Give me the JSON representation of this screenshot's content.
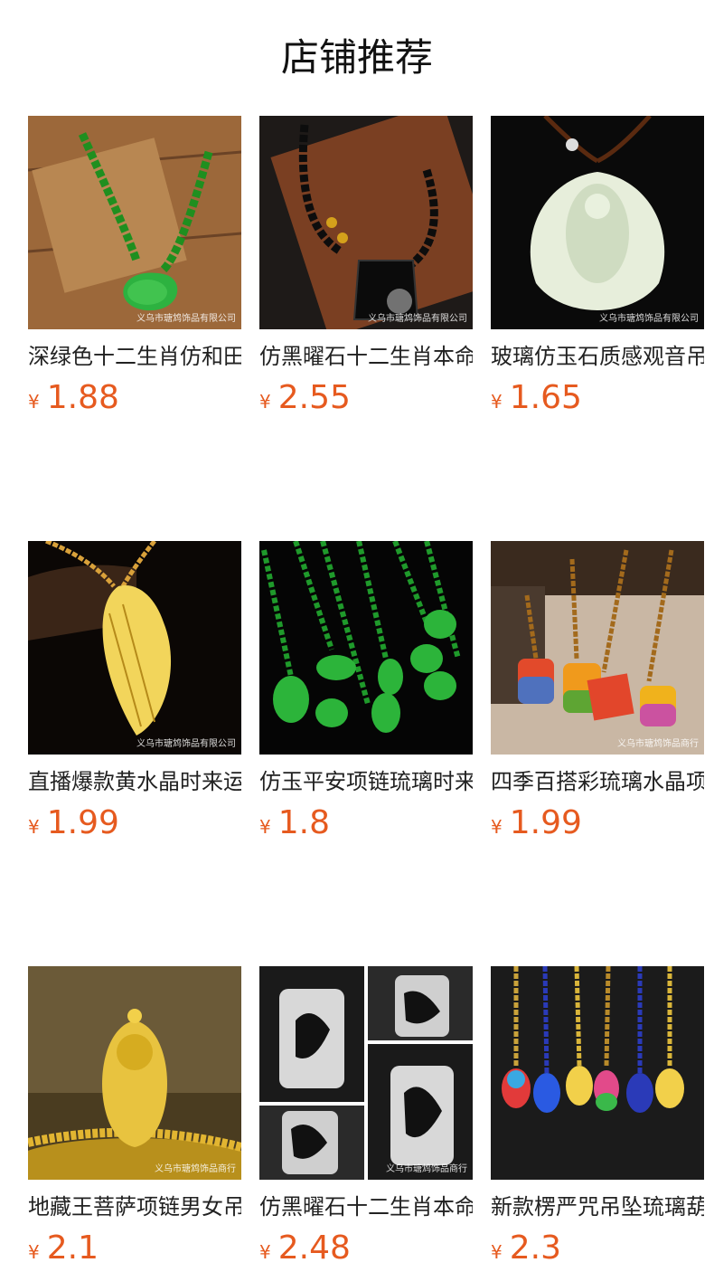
{
  "header": {
    "title": "店铺推荐"
  },
  "products": [
    {
      "name": "深绿色十二生肖仿和田玉",
      "currency": "¥",
      "price": "1.88",
      "watermark": "义乌市瑭鸩饰品有限公司",
      "image_icon": "green-zodiac-pendant-icon"
    },
    {
      "name": "仿黑曜石十二生肖本命佛",
      "currency": "¥",
      "price": "2.55",
      "watermark": "义乌市瑭鸩饰品有限公司",
      "image_icon": "black-obsidian-pendant-icon"
    },
    {
      "name": "玻璃仿玉石质感观音吊坠",
      "currency": "¥",
      "price": "1.65",
      "watermark": "义乌市瑭鸩饰品有限公司",
      "image_icon": "white-guanyin-pendant-icon"
    },
    {
      "name": "直播爆款黄水晶时来运转",
      "currency": "¥",
      "price": "1.99",
      "watermark": "义乌市瑭鸩饰品有限公司",
      "image_icon": "yellow-cicada-pendant-icon"
    },
    {
      "name": "仿玉平安项链琉璃时来运",
      "currency": "¥",
      "price": "1.8",
      "watermark": "",
      "image_icon": "green-jade-necklaces-icon"
    },
    {
      "name": "四季百搭彩琉璃水晶项链",
      "currency": "¥",
      "price": "1.99",
      "watermark": "义乌市瑭鸩饰品商行",
      "image_icon": "rainbow-glass-pendants-icon"
    },
    {
      "name": "地藏王菩萨项链男女吊坠",
      "currency": "¥",
      "price": "2.1",
      "watermark": "义乌市瑭鸩饰品商行",
      "image_icon": "amber-bodhisattva-pendant-icon"
    },
    {
      "name": "仿黑曜石十二生肖本命佛",
      "currency": "¥",
      "price": "2.48",
      "watermark": "义乌市瑭鸩饰品商行",
      "image_icon": "obsidian-zodiac-collage-icon"
    },
    {
      "name": "新款楞严咒吊坠琉璃葫芦",
      "currency": "¥",
      "price": "2.3",
      "watermark": "",
      "image_icon": "gourd-glass-pendants-icon"
    }
  ]
}
